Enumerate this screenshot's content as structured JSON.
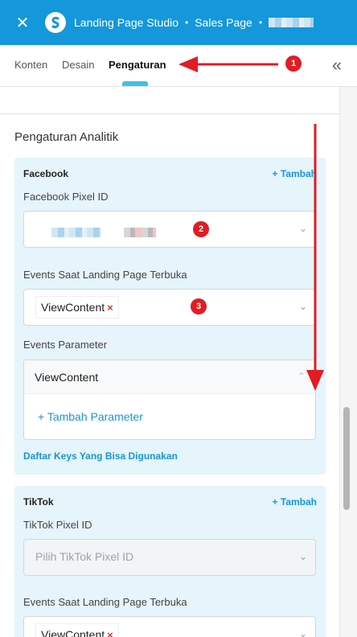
{
  "topbar": {
    "close_glyph": "✕",
    "app_name": "Landing Page Studio",
    "separator": "•",
    "page_name": "Sales Page",
    "separator2": "•"
  },
  "tabs": [
    {
      "label": "Konten"
    },
    {
      "label": "Desain"
    },
    {
      "label": "Pengaturan"
    }
  ],
  "collapse_glyph": "«",
  "section_title": "Pengaturan Analitik",
  "facebook": {
    "title": "Facebook",
    "add_label": "+ Tambah",
    "pixel_label": "Facebook Pixel ID",
    "events_label": "Events Saat Landing Page Terbuka",
    "event_tag": "ViewContent",
    "params_label": "Events Parameter",
    "param_event": "ViewContent",
    "add_param_label": "+ Tambah Parameter",
    "keys_link": "Daftar Keys Yang Bisa Digunakan"
  },
  "tiktok": {
    "title": "TikTok",
    "add_label": "+ Tambah",
    "pixel_label": "TikTok Pixel ID",
    "pixel_placeholder": "Pilih TikTok Pixel ID",
    "events_label": "Events Saat Landing Page Terbuka",
    "event_tag": "ViewContent"
  },
  "annotations": [
    "1",
    "2",
    "3"
  ],
  "colors": {
    "topbar": "#1497db",
    "accent": "#1497db",
    "card_bg": "#e6f4fb",
    "annotation_red": "#e31b23",
    "remove_x": "#e0322f"
  },
  "icons": {
    "close": "close-icon",
    "logo": "studio-logo-icon",
    "collapse": "double-chevron-left-icon",
    "select_chevron": "chevron-down-icon",
    "expand_chevron": "chevron-up-icon",
    "remove": "remove-x-icon"
  }
}
